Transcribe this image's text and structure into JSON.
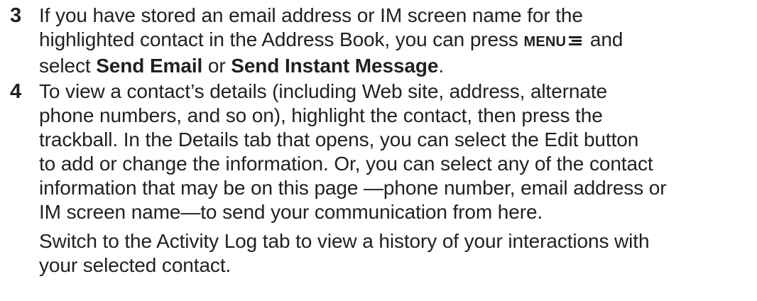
{
  "steps": [
    {
      "number": "3",
      "line1": "If you have stored an email address or IM screen name for the",
      "line2_pre": "highlighted contact in the Address Book, you can press ",
      "menu_key": "MENU",
      "menu_icon": "menu-icon",
      "line2_post": " and",
      "line3_pre": "select ",
      "send_email": "Send Email",
      "line3_mid": " or ",
      "send_im": "Send Instant Message",
      "line3_post": "."
    },
    {
      "number": "4",
      "lines": [
        "To view a contact’s details (including Web site, address, alternate",
        "phone numbers, and so on), highlight the contact, then press the",
        "trackball. In the Details tab that opens, you can select the Edit button",
        "to add or change the information. Or, you can select any of the contact",
        "information that may be on this page —phone number, email address or",
        "IM screen name—to send your communication from here."
      ],
      "para2_lines": [
        "Switch to the Activity Log tab to view a history of your interactions with",
        "your selected contact."
      ]
    }
  ]
}
